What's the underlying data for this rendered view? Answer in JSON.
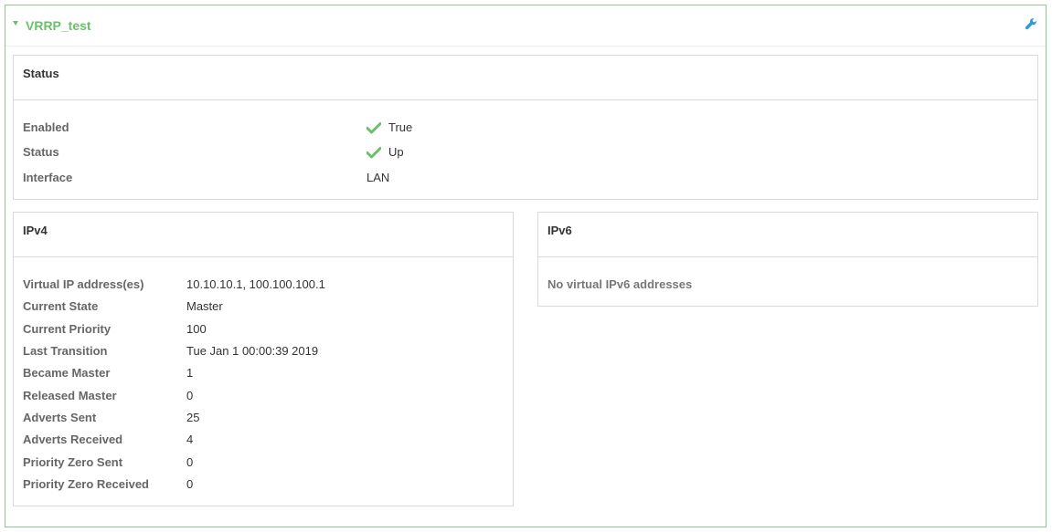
{
  "section": {
    "title": "VRRP_test",
    "expanded": true,
    "accent": "#6cbf6c"
  },
  "header_icons": {
    "config": "wrench-icon"
  },
  "status_panel": {
    "title": "Status",
    "rows": [
      {
        "label": "Enabled",
        "value": "True",
        "icon": "check-icon"
      },
      {
        "label": "Status",
        "value": "Up",
        "icon": "check-icon"
      },
      {
        "label": "Interface",
        "value": "LAN"
      }
    ]
  },
  "ipv4_panel": {
    "title": "IPv4",
    "rows": [
      {
        "label": "Virtual IP address(es)",
        "value": "10.10.10.1, 100.100.100.1"
      },
      {
        "label": "Current State",
        "value": "Master"
      },
      {
        "label": "Current Priority",
        "value": "100"
      },
      {
        "label": "Last Transition",
        "value": "Tue Jan 1 00:00:39 2019"
      },
      {
        "label": "Became Master",
        "value": "1"
      },
      {
        "label": "Released Master",
        "value": "0"
      },
      {
        "label": "Adverts Sent",
        "value": "25"
      },
      {
        "label": "Adverts Received",
        "value": "4"
      },
      {
        "label": "Priority Zero Sent",
        "value": "0"
      },
      {
        "label": "Priority Zero Received",
        "value": "0"
      }
    ]
  },
  "ipv6_panel": {
    "title": "IPv6",
    "message": "No virtual IPv6 addresses"
  }
}
